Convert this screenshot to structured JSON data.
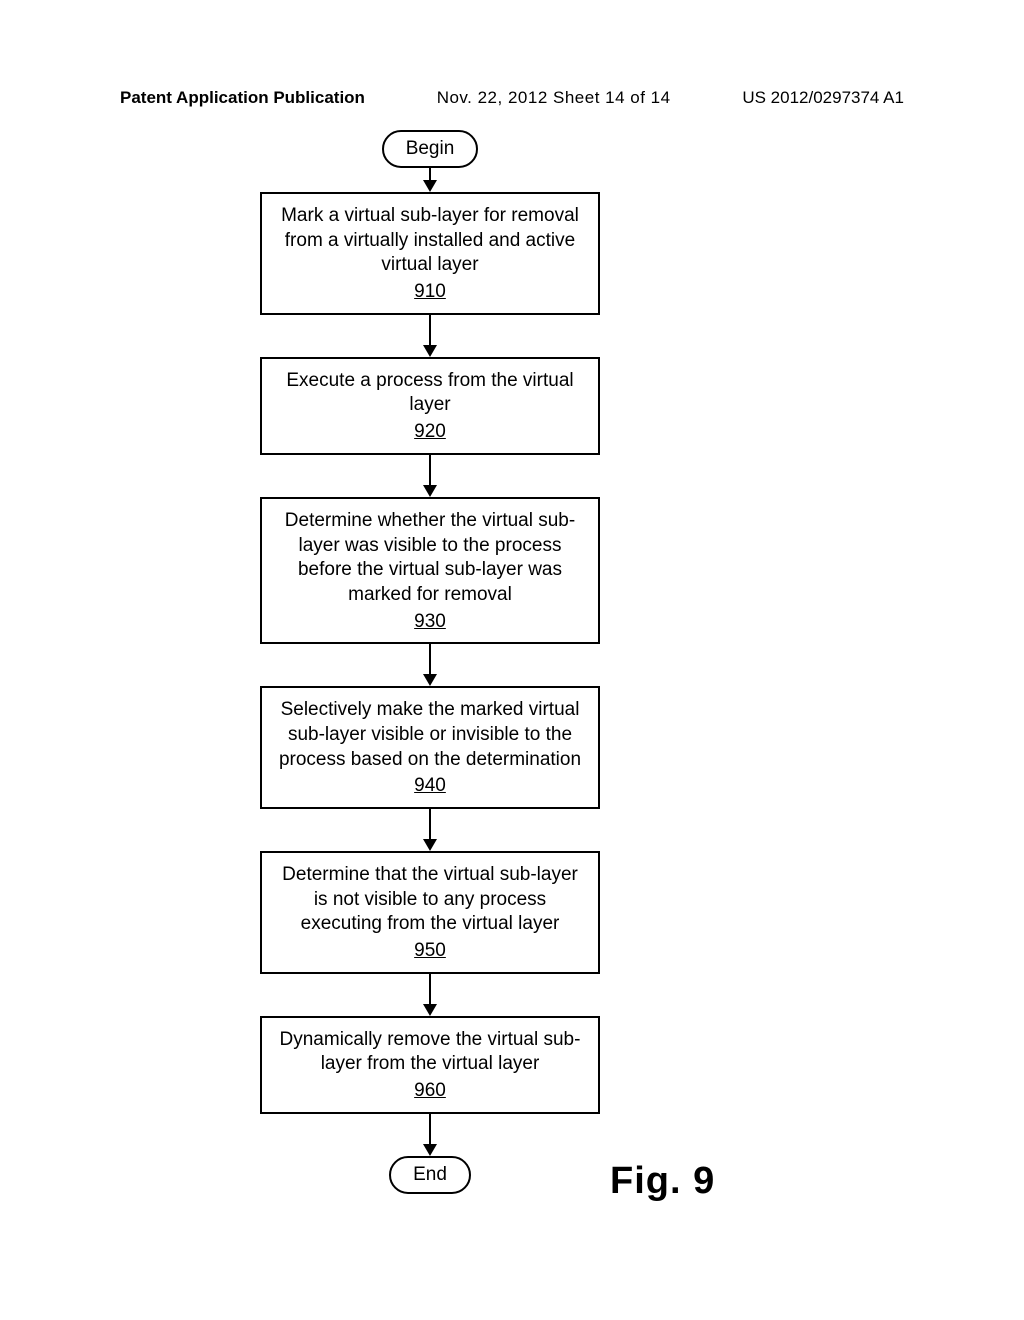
{
  "header": {
    "left": "Patent Application Publication",
    "center": "Nov. 22, 2012  Sheet 14 of 14",
    "right": "US 2012/0297374 A1"
  },
  "flowchart": {
    "begin": "Begin",
    "end": "End",
    "steps": [
      {
        "text": "Mark a virtual sub-layer for removal from a virtually installed and active virtual layer",
        "ref": "910"
      },
      {
        "text": "Execute a process from the virtual layer",
        "ref": "920"
      },
      {
        "text": "Determine whether the virtual sub-layer was visible to the process before the virtual sub-layer was marked for removal",
        "ref": "930"
      },
      {
        "text": "Selectively make the marked virtual sub-layer visible or invisible to the process based on the determination",
        "ref": "940"
      },
      {
        "text": "Determine that the virtual sub-layer is not visible to any process executing from the virtual layer",
        "ref": "950"
      },
      {
        "text": "Dynamically remove the virtual sub-layer from the virtual layer",
        "ref": "960"
      }
    ]
  },
  "figure_label": "Fig. 9"
}
